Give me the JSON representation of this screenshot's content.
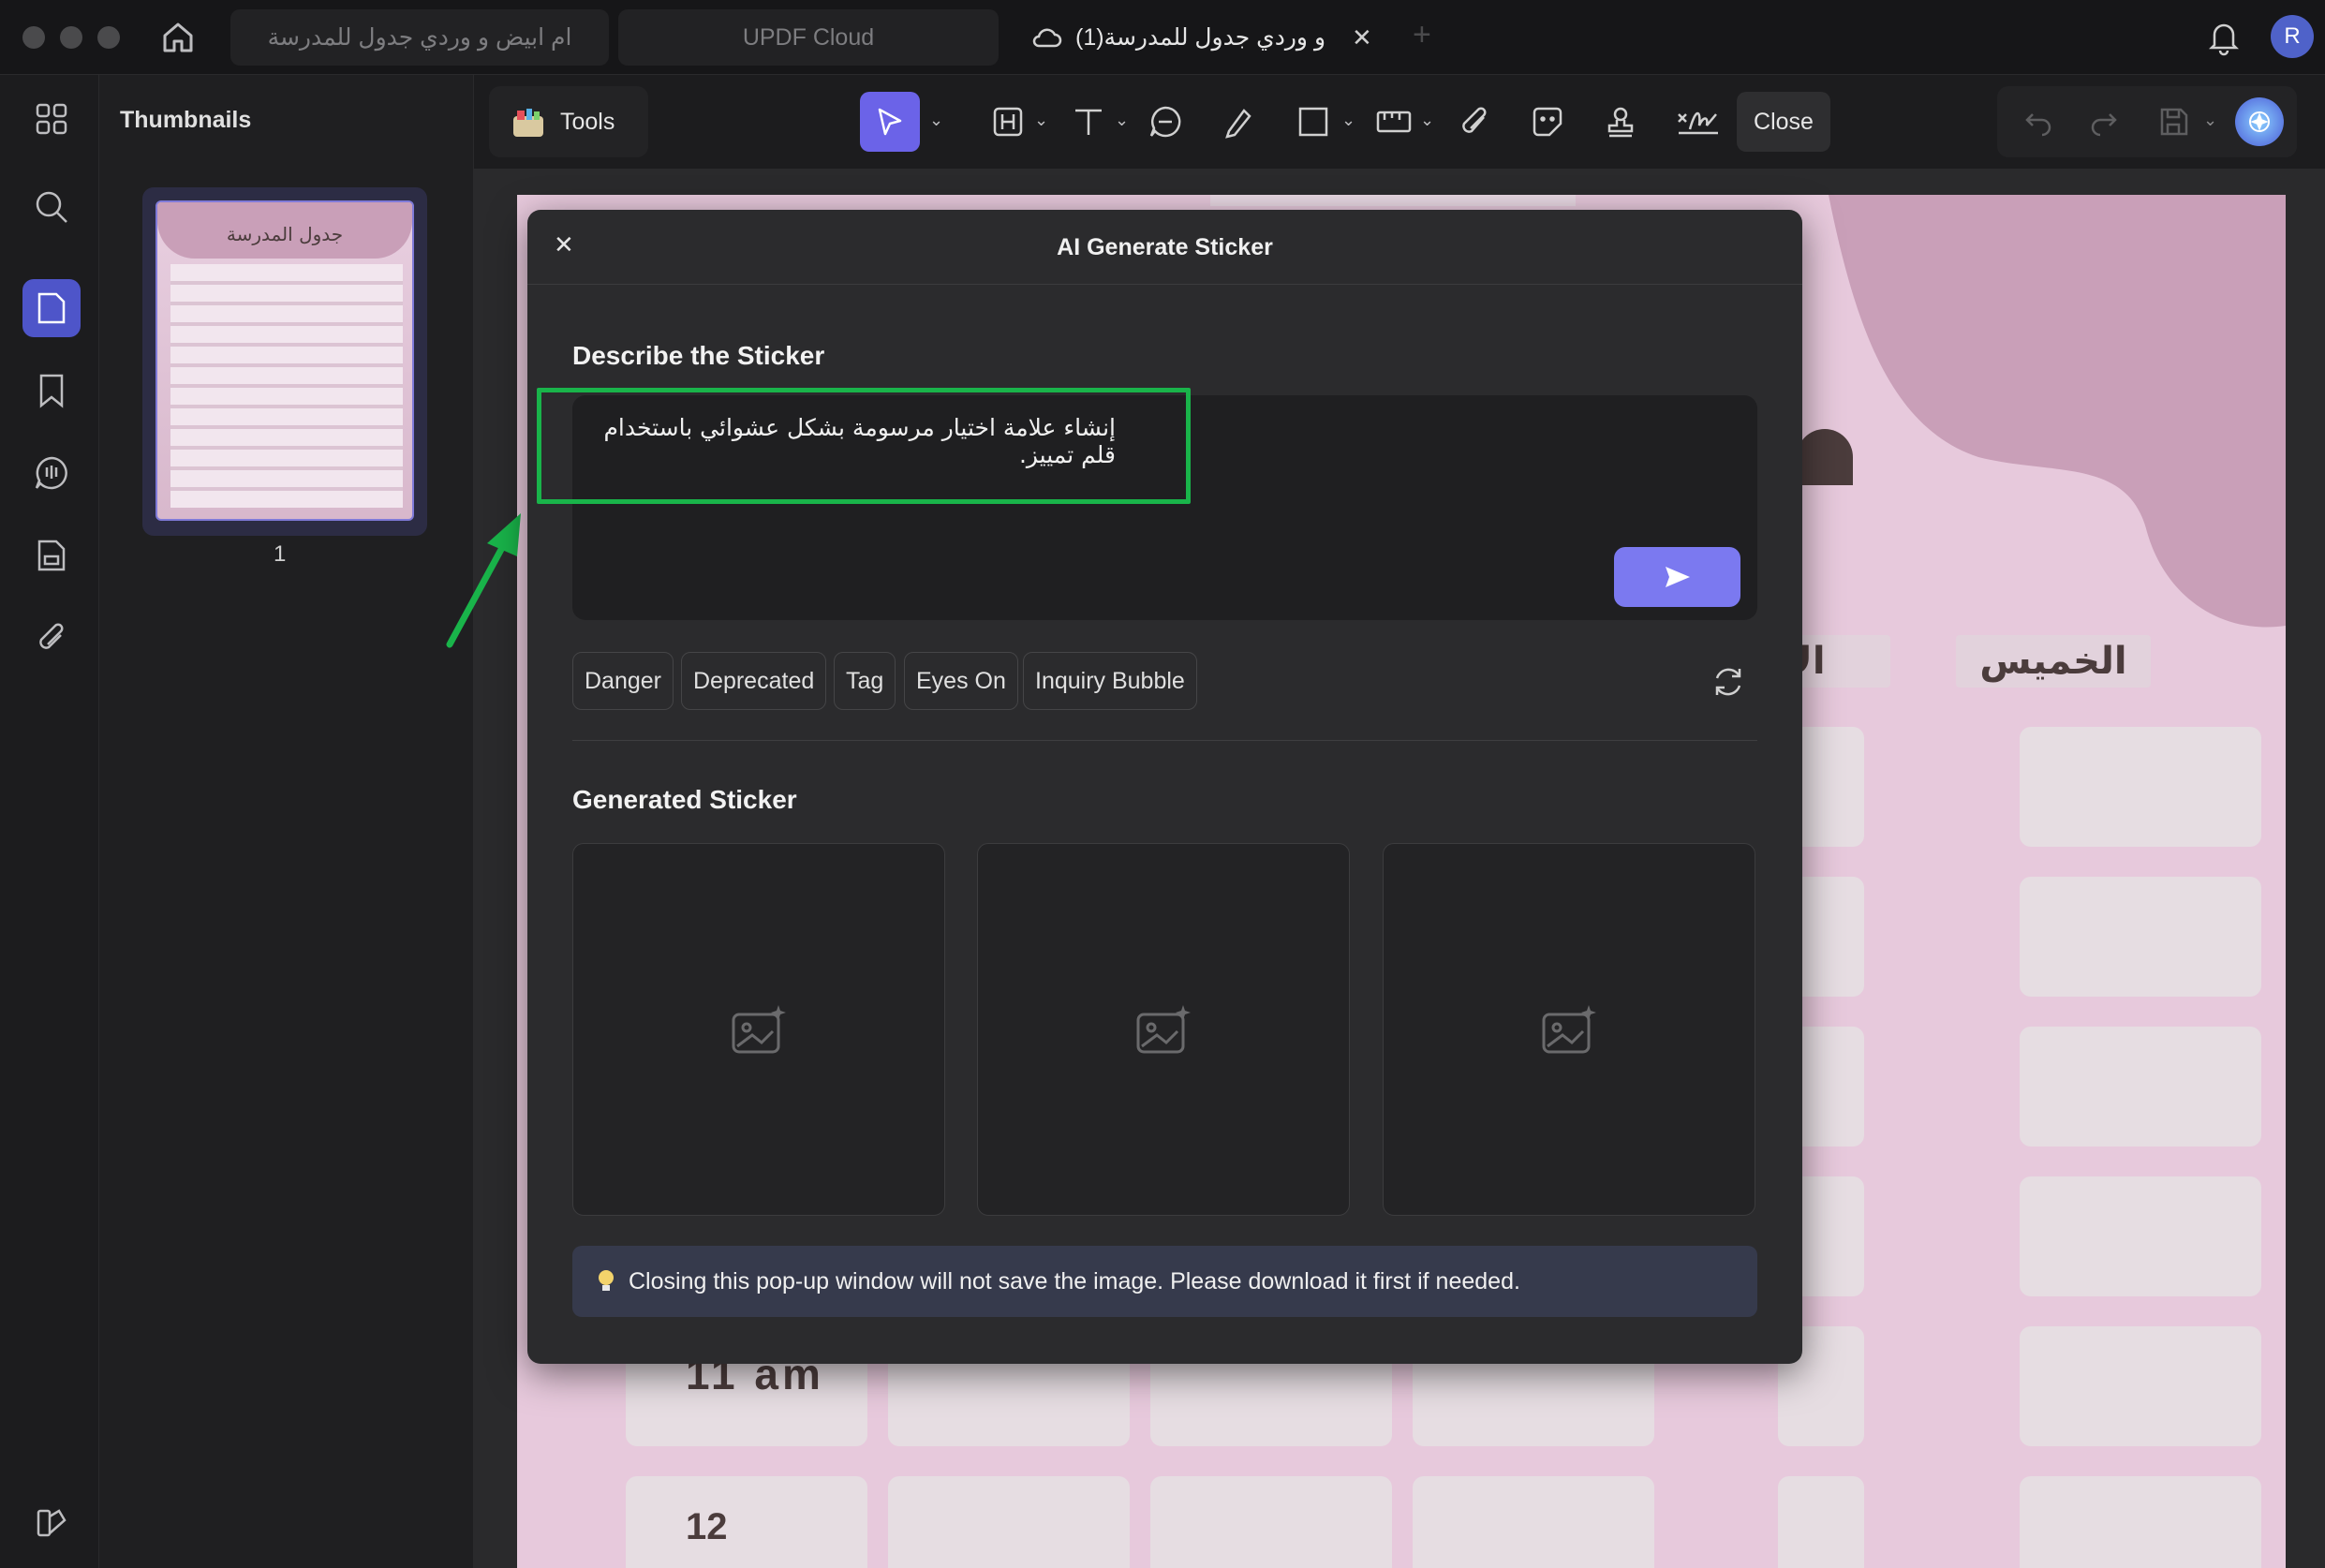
{
  "titlebar": {
    "tabs": [
      {
        "label": "ام ابيض و وردي جدول للمدرسة",
        "state": "inactive"
      },
      {
        "label": "UPDF Cloud",
        "state": "inactive"
      },
      {
        "label": "و وردي جدول للمدرسة(1)",
        "state": "active"
      }
    ],
    "avatar_letter": "R"
  },
  "sidebar": {
    "items": [
      "grid-icon",
      "search-icon",
      "thumbnails-icon",
      "bookmark-icon",
      "comment-icon",
      "page-icon",
      "attachment-icon"
    ],
    "active_item": "thumbnails-icon"
  },
  "thumbnails": {
    "title": "Thumbnails",
    "page_number": "1",
    "page_heading": "جدول المدرسة"
  },
  "toolbar": {
    "tools_label": "Tools",
    "close_label": "Close"
  },
  "document": {
    "day_labels": [
      "الخميس",
      "الار"
    ],
    "time_labels": [
      "11 am",
      "12"
    ]
  },
  "modal": {
    "title": "AI Generate Sticker",
    "describe_title": "Describe the Sticker",
    "prompt_value": "إنشاء علامة اختيار مرسومة بشكل عشوائي باستخدام قلم تمييز.",
    "suggestions": [
      "Danger",
      "Deprecated",
      "Tag",
      "Eyes On",
      "Inquiry Bubble"
    ],
    "generated_title": "Generated Sticker",
    "notice": "Closing this pop-up window will not save the image. Please download it first if needed."
  },
  "colors": {
    "accent": "#7b79f0",
    "highlight_box": "#19b44a",
    "arrow": "#19b44a"
  }
}
